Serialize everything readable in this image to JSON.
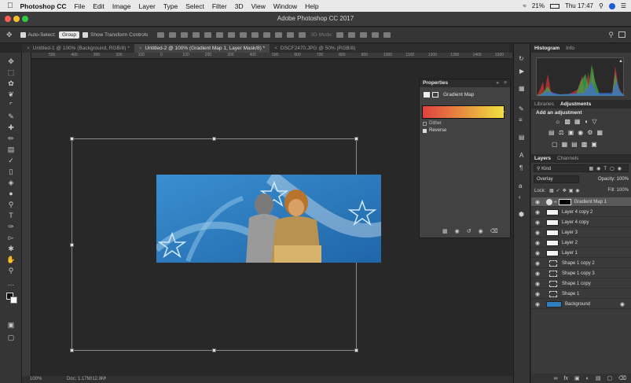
{
  "menubar": {
    "app_name": "Photoshop CC",
    "items": [
      "File",
      "Edit",
      "Image",
      "Layer",
      "Type",
      "Select",
      "Filter",
      "3D",
      "View",
      "Window",
      "Help"
    ],
    "battery": "21%",
    "time": "Thu 17:47"
  },
  "window": {
    "title": "Adobe Photoshop CC 2017"
  },
  "options_bar": {
    "auto_select_label": "Auto-Select:",
    "auto_select_value": "Group",
    "show_transform_label": "Show Transform Controls",
    "mode_3d_label": "3D Mode:"
  },
  "doc_tabs": [
    {
      "label": "Untitled-1 @ 100% (Background, RGB/8) *",
      "active": false
    },
    {
      "label": "Untitled-2 @ 100% (Gradient Map 1, Layer Mask/8) *",
      "active": true
    },
    {
      "label": "DSCF2470.JPG @ 50% (RGB/8)",
      "active": false
    }
  ],
  "ruler_ticks": [
    "500",
    "450",
    "400",
    "350",
    "300",
    "250",
    "200",
    "150",
    "100",
    "50",
    "0",
    "50",
    "100",
    "150",
    "200",
    "250",
    "300",
    "350",
    "400",
    "450",
    "500",
    "550",
    "600",
    "650",
    "700",
    "750",
    "800",
    "850",
    "900",
    "950",
    "1000",
    "1050",
    "1100",
    "1150",
    "1200",
    "1250",
    "1300",
    "1350",
    "1400",
    "1450",
    "1500"
  ],
  "status": {
    "zoom": "100%",
    "doc": "Doc: 1.17M/12.8M"
  },
  "properties": {
    "title": "Properties",
    "subtitle": "Gradient Map",
    "dither_label": "Dither",
    "reverse_label": "Reverse",
    "gradient_colors": [
      "#e04040",
      "#f0e040"
    ]
  },
  "panels": {
    "top_tabs": [
      "Histogram",
      "Info"
    ],
    "mid_tabs": [
      "Libraries",
      "Adjustments"
    ],
    "add_adjustment": "Add an adjustment",
    "layers_tabs": [
      "Layers",
      "Channels"
    ],
    "kind_label": "Kind",
    "blend_mode": "Overlay",
    "opacity_label": "Opacity: 100%",
    "lock_label": "Lock:",
    "fill_label": "Fill: 100%"
  },
  "layers": [
    {
      "name": "Gradient Map 1",
      "type": "adjustment",
      "selected": true
    },
    {
      "name": "Layer 4 copy 2",
      "type": "pixel"
    },
    {
      "name": "Layer 4 copy",
      "type": "pixel"
    },
    {
      "name": "Layer 3",
      "type": "pixel"
    },
    {
      "name": "Layer 2",
      "type": "pixel"
    },
    {
      "name": "Layer 1",
      "type": "pixel"
    },
    {
      "name": "Shape 1 copy 2",
      "type": "shape"
    },
    {
      "name": "Shape 1 copy 3",
      "type": "shape"
    },
    {
      "name": "Shape 1 copy",
      "type": "shape"
    },
    {
      "name": "Shape 1",
      "type": "shape"
    },
    {
      "name": "Background",
      "type": "background"
    }
  ],
  "colors": {
    "accent_blue": "#2f7fc1",
    "panel_bg": "#3a3a3a"
  }
}
